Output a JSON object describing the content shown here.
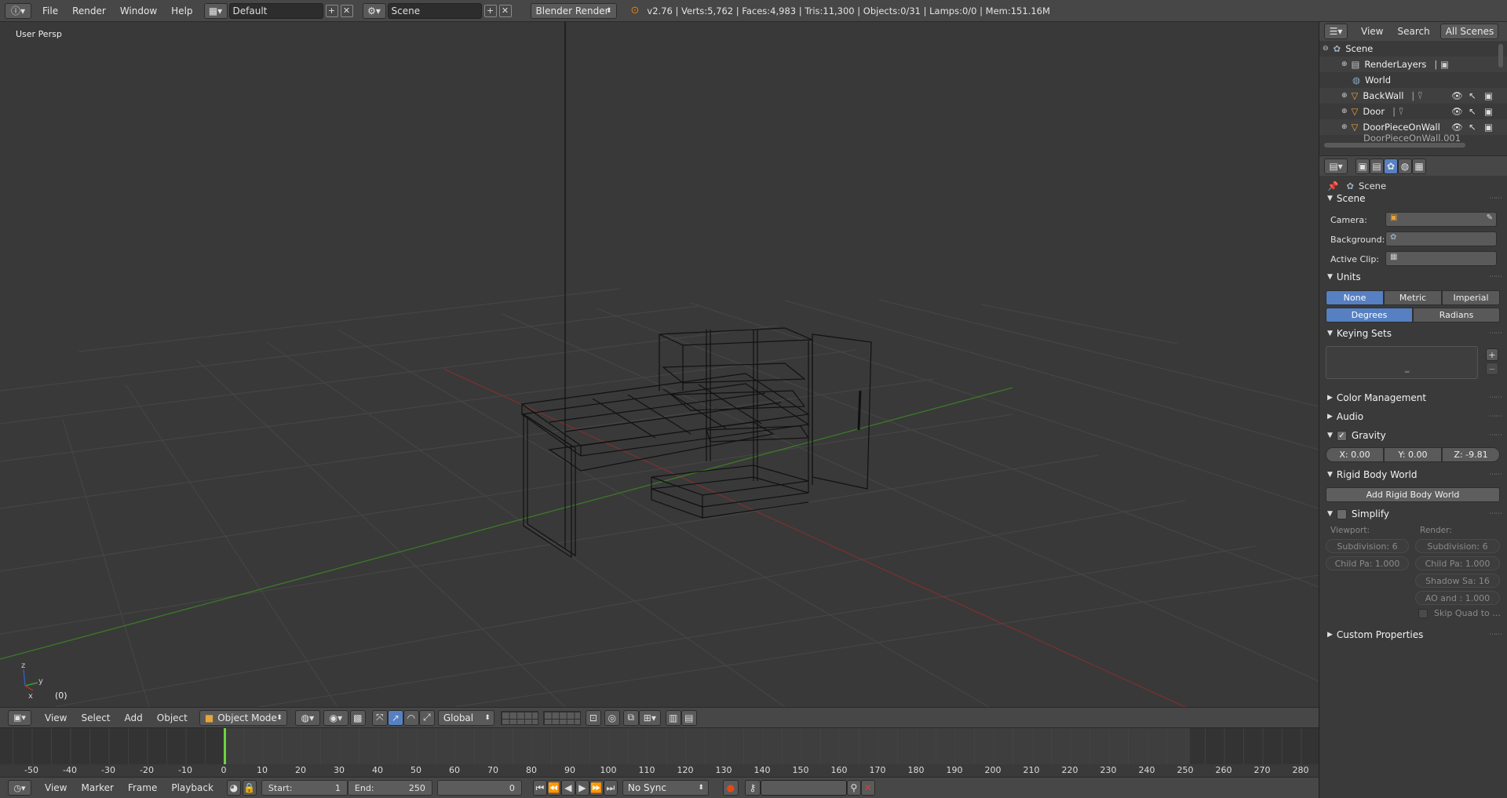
{
  "topbar": {
    "menus": [
      "File",
      "Render",
      "Window",
      "Help"
    ],
    "layout": "Default",
    "scene": "Scene",
    "engine": "Blender Render",
    "stats": "v2.76 | Verts:5,762 | Faces:4,983 | Tris:11,300 | Objects:0/31 | Lamps:0/0 | Mem:151.16M"
  },
  "viewport": {
    "view_label": "User Persp",
    "frame_label": "(0)"
  },
  "view3d_header": {
    "menus": [
      "View",
      "Select",
      "Add",
      "Object"
    ],
    "mode": "Object Mode",
    "orientation": "Global"
  },
  "timeline": {
    "ticks": [
      "-50",
      "-40",
      "-30",
      "-20",
      "-10",
      "0",
      "10",
      "20",
      "30",
      "40",
      "50",
      "60",
      "70",
      "80",
      "90",
      "100",
      "110",
      "120",
      "130",
      "140",
      "150",
      "160",
      "170",
      "180",
      "190",
      "200",
      "210",
      "220",
      "230",
      "240",
      "250",
      "260",
      "270",
      "280"
    ],
    "menus": [
      "View",
      "Marker",
      "Frame",
      "Playback"
    ],
    "start_label": "Start:",
    "start_value": "1",
    "end_label": "End:",
    "end_value": "250",
    "current_frame": "0",
    "sync": "No Sync"
  },
  "outliner": {
    "menus": [
      "View",
      "Search"
    ],
    "filter": "All Scenes",
    "items": [
      {
        "label": "Scene"
      },
      {
        "label": "RenderLayers"
      },
      {
        "label": "World"
      },
      {
        "label": "BackWall"
      },
      {
        "label": "Door"
      },
      {
        "label": "DoorPieceOnWall"
      },
      {
        "label": "DoorPieceOnWall.001"
      }
    ]
  },
  "properties": {
    "context": "Scene",
    "scene_panel": {
      "title": "Scene",
      "camera_label": "Camera:",
      "background_label": "Background:",
      "active_clip_label": "Active Clip:"
    },
    "units_panel": {
      "title": "Units",
      "systems": [
        "None",
        "Metric",
        "Imperial"
      ],
      "rotation": [
        "Degrees",
        "Radians"
      ]
    },
    "keying_sets_title": "Keying Sets",
    "color_management_title": "Color Management",
    "audio_title": "Audio",
    "gravity_panel": {
      "title": "Gravity",
      "x": "X:  0.00",
      "y": "Y:  0.00",
      "z": "Z:  -9.81"
    },
    "rigid_body_panel": {
      "title": "Rigid Body World",
      "button": "Add Rigid Body World"
    },
    "simplify_panel": {
      "title": "Simplify",
      "viewport_label": "Viewport:",
      "render_label": "Render:",
      "vp_subdivision": "Subdivision:  6",
      "vp_child": "Child Pa: 1.000",
      "r_subdivision": "Subdivision:  6",
      "r_child": "Child Pa: 1.000",
      "r_shadow": "Shadow Sa:  16",
      "r_ao": "AO and : 1.000",
      "skip_quad": "Skip Quad to ..."
    },
    "custom_props_title": "Custom Properties"
  },
  "colors": {
    "accent": "#5680c2",
    "x_axis": "#b03030",
    "y_axis": "#3a9a2a",
    "playhead": "#6cd43f"
  }
}
